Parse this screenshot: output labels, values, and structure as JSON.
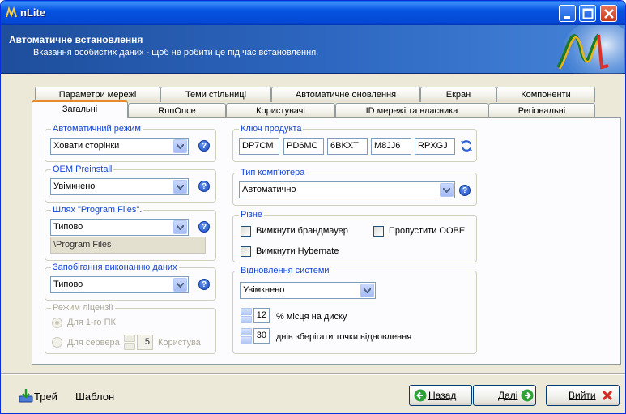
{
  "window": {
    "title": "nLite"
  },
  "header": {
    "title": "Автоматичне встановлення",
    "subtitle": "Вказання особистих даних - щоб не робити це під час встановлення."
  },
  "tabs_row1": [
    {
      "label": "Параметри мережі"
    },
    {
      "label": "Теми стільниці"
    },
    {
      "label": "Автоматичне оновлення"
    },
    {
      "label": "Екран"
    },
    {
      "label": "Компоненти"
    }
  ],
  "tabs_row2": [
    {
      "label": "Загальні",
      "active": true
    },
    {
      "label": "RunOnce"
    },
    {
      "label": "Користувачі"
    },
    {
      "label": "ID мережі та власника"
    },
    {
      "label": "Регіональні"
    }
  ],
  "left": {
    "auto_mode": {
      "label": "Автоматичний режим",
      "value": "Ховати сторінки"
    },
    "oem": {
      "label": "OEM Preinstall",
      "value": "Увімкнено"
    },
    "program_files": {
      "label": "Шлях \"Program Files\".",
      "value": "Типово",
      "path": "\\Program Files"
    },
    "dep": {
      "label": "Запобігання виконанню даних",
      "value": "Типово"
    },
    "license": {
      "label": "Режим ліцензії",
      "option1": "Для 1-го ПК",
      "option2": "Для сервера",
      "count": "5",
      "users_label": "Користува"
    }
  },
  "right": {
    "product_key": {
      "label": "Ключ продукта",
      "parts": [
        "DP7CM",
        "PD6MC",
        "6BKXT",
        "M8JJ6",
        "RPXGJ"
      ]
    },
    "computer_type": {
      "label": "Тип комп'ютера",
      "value": "Автоматично"
    },
    "misc": {
      "label": "Різне",
      "firewall": "Вимкнути брандмауер",
      "skip_oobe": "Пропустити OOBE",
      "hibernate": "Вимкнути Hybernate"
    },
    "restore": {
      "label": "Відновлення системи",
      "value": "Увімкнено",
      "disk_percent": "12",
      "disk_label": "% місця на диску",
      "days": "30",
      "days_label": "днів зберігати точки відновлення"
    }
  },
  "footer": {
    "tray": "Трей",
    "template": "Шаблон",
    "back": "Назад",
    "next": "Далі",
    "exit": "Вийти"
  },
  "help_glyph": "?",
  "colors": {
    "accent": "#1546d4",
    "titlebar": "#0553e0",
    "header": "#2e68c2"
  }
}
